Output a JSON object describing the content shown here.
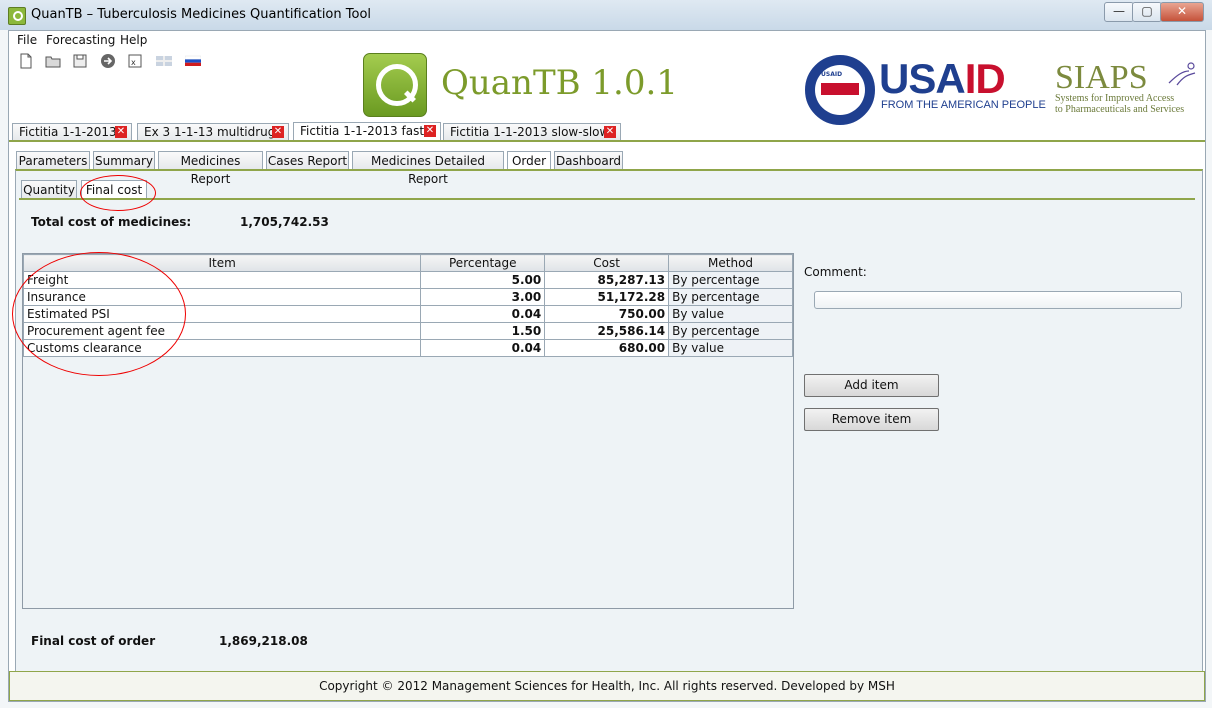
{
  "window": {
    "title": "QuanTB – Tuberculosis Medicines Quantification Tool",
    "minimize": "—",
    "maximize": "▢",
    "close": "✕"
  },
  "menu": [
    "File",
    "Forecasting",
    "Help"
  ],
  "toolbar_icons": [
    "new-file-icon",
    "open-folder-icon",
    "save-icon",
    "arrow-right-icon",
    "export-icon",
    "flag-uk-icon",
    "flag-russia-icon"
  ],
  "header": {
    "app_name": "QuanTB 1.0.1",
    "usaid_usa": "USA",
    "usaid_id": "ID",
    "usaid_tagline": "FROM THE AMERICAN PEOPLE",
    "seal_text": "USAID",
    "siaps_name": "SIAPS",
    "siaps_tagline_1": "Systems for Improved Access",
    "siaps_tagline_2": "to Pharmaceuticals and Services"
  },
  "doc_tabs": [
    {
      "label": "Fictitia 1-1-2013"
    },
    {
      "label": "Ex 3 1-1-13 multidrug"
    },
    {
      "label": "Fictitia 1-1-2013 fast",
      "active": true
    },
    {
      "label": "Fictitia 1-1-2013 slow-slow"
    }
  ],
  "report_tabs": [
    "Parameters",
    "Summary",
    "Medicines Report",
    "Cases Report",
    "Medicines Detailed Report",
    "Order",
    "Dashboard"
  ],
  "active_report_tab": "Order",
  "sub_tabs": [
    "Quantity",
    "Final cost"
  ],
  "active_sub_tab": "Final cost",
  "totals": {
    "medicines_label": "Total cost of medicines:",
    "medicines_value": "1,705,742.53",
    "order_label": "Final cost of order",
    "order_value": "1,869,218.08"
  },
  "table": {
    "columns": [
      "Item",
      "Percentage",
      "Cost",
      "Method"
    ],
    "rows": [
      [
        "Freight",
        "5.00",
        "85,287.13",
        "By percentage"
      ],
      [
        "Insurance",
        "3.00",
        "51,172.28",
        "By percentage"
      ],
      [
        "Estimated PSI",
        "0.04",
        "750.00",
        "By value"
      ],
      [
        "Procurement agent fee",
        "1.50",
        "25,586.14",
        "By percentage"
      ],
      [
        "Customs clearance",
        "0.04",
        "680.00",
        "By value"
      ]
    ]
  },
  "comment": {
    "label": "Comment:",
    "value": ""
  },
  "buttons": {
    "add": "Add item",
    "remove": "Remove item"
  },
  "footer": "Copyright © 2012 Management Sciences for Health, Inc. All rights reserved. Developed by MSH",
  "colors": {
    "accent_green": "#8fa54a",
    "usaid_blue": "#1f3f8f",
    "usaid_red": "#c8102e",
    "annotation_red": "#e00000"
  }
}
